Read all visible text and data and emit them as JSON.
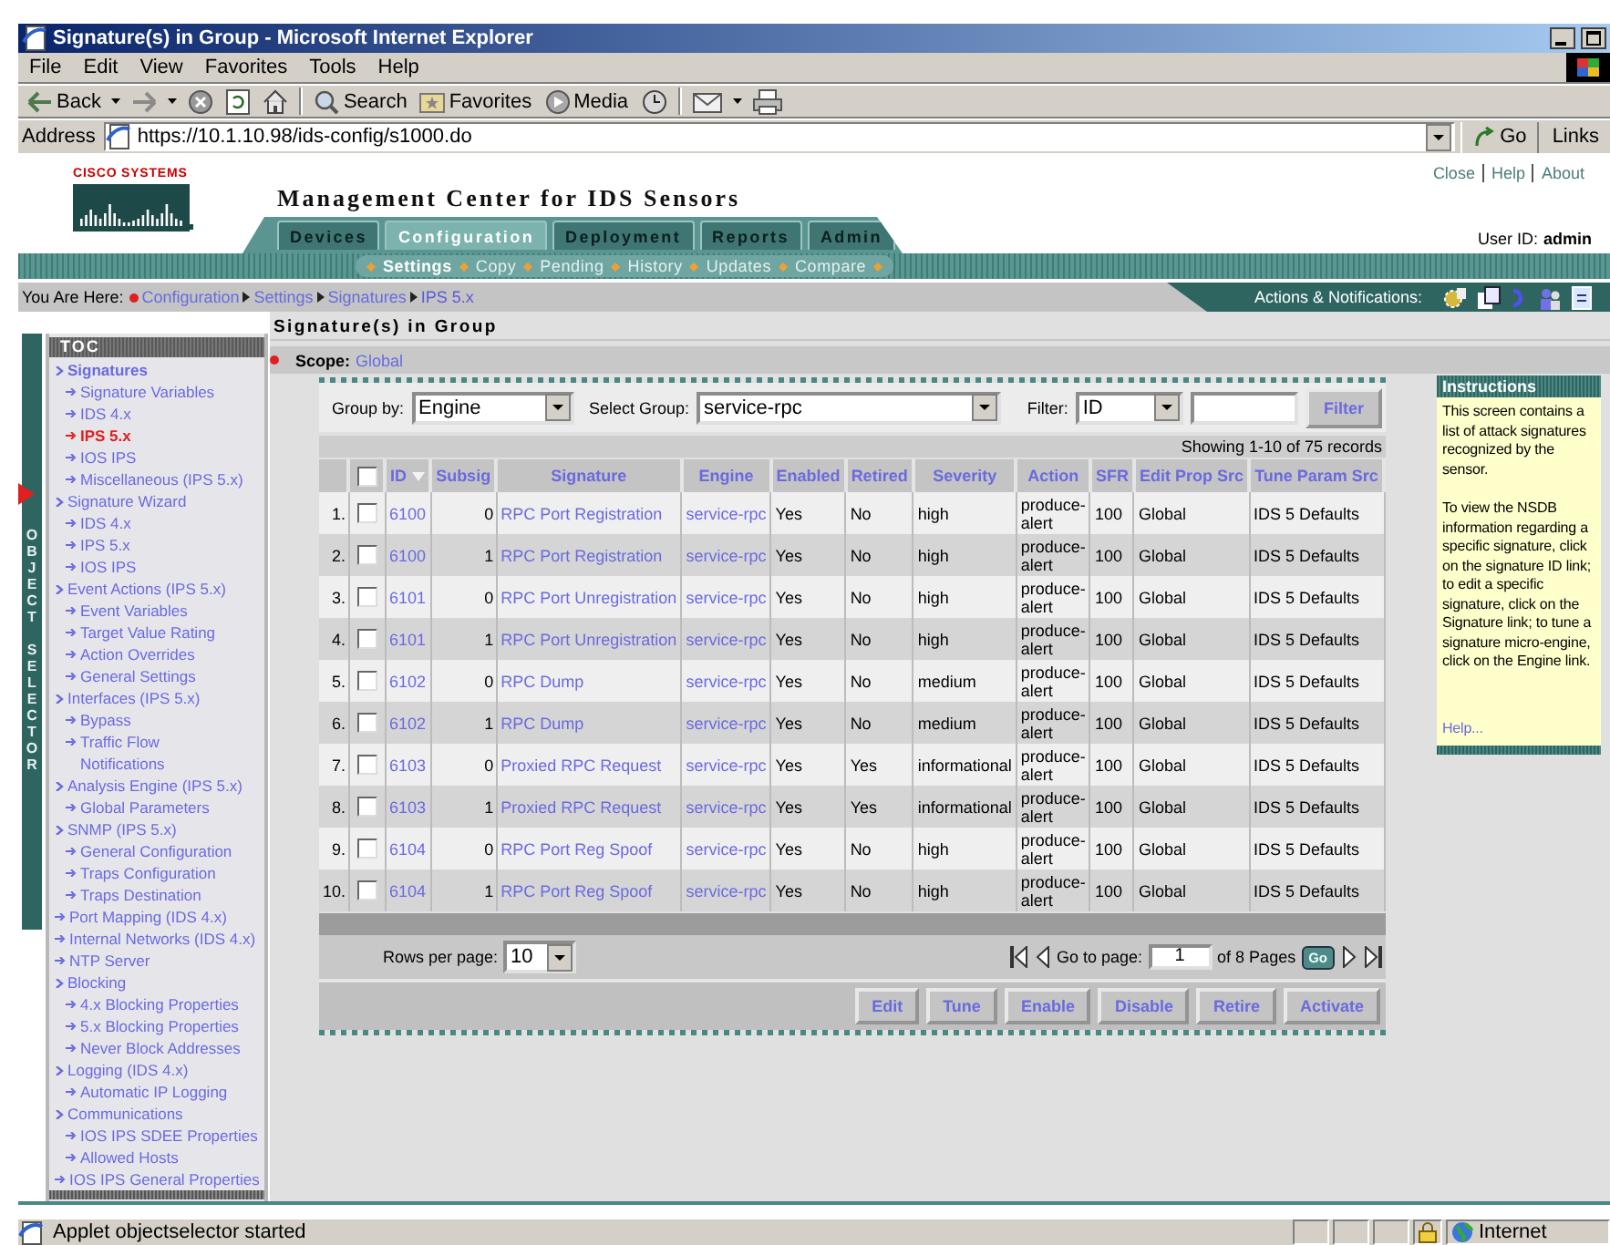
{
  "window": {
    "title": "Signature(s) in Group - Microsoft Internet Explorer"
  },
  "menu": [
    "File",
    "Edit",
    "View",
    "Favorites",
    "Tools",
    "Help"
  ],
  "toolbar": [
    {
      "kind": "back",
      "label": "Back"
    },
    {
      "kind": "forward"
    },
    {
      "kind": "stop"
    },
    {
      "kind": "refresh"
    },
    {
      "kind": "home"
    },
    {
      "kind": "search",
      "label": "Search"
    },
    {
      "kind": "favorites",
      "label": "Favorites"
    },
    {
      "kind": "media",
      "label": "Media"
    },
    {
      "kind": "history"
    },
    {
      "kind": "mail"
    },
    {
      "kind": "print"
    }
  ],
  "address": {
    "label": "Address",
    "url": "https://10.1.10.98/ids-config/s1000.do",
    "go": "Go",
    "links": "Links"
  },
  "header": {
    "logo": "CISCO SYSTEMS",
    "title": "Management Center for IDS Sensors",
    "links": [
      "Close",
      "Help",
      "About"
    ],
    "user_label": "User ID:",
    "user": "admin"
  },
  "tabs": [
    {
      "label": "Devices",
      "selected": false
    },
    {
      "label": "Configuration",
      "selected": true
    },
    {
      "label": "Deployment",
      "selected": false
    },
    {
      "label": "Reports",
      "selected": false
    },
    {
      "label": "Admin",
      "selected": false
    }
  ],
  "subnav": [
    {
      "label": "Settings",
      "selected": true
    },
    {
      "label": "Copy",
      "selected": false
    },
    {
      "label": "Pending",
      "selected": false
    },
    {
      "label": "History",
      "selected": false
    },
    {
      "label": "Updates",
      "selected": false
    },
    {
      "label": "Compare",
      "selected": false
    }
  ],
  "breadcrumb": {
    "label": "You Are Here:",
    "items": [
      "Configuration",
      "Settings",
      "Signatures",
      "IPS 5.x"
    ]
  },
  "actions_label": "Actions & Notifications:",
  "object_selector": [
    "OBJECT",
    "SELECTOR"
  ],
  "toc": {
    "title": "TOC",
    "items": [
      {
        "label": "Signatures",
        "selected": false,
        "children": [
          {
            "label": "Signature Variables",
            "selected": false
          },
          {
            "label": "IDS 4.x",
            "selected": false
          },
          {
            "label": "IPS 5.x",
            "selected": true
          },
          {
            "label": "IOS IPS",
            "selected": false
          },
          {
            "label": "Miscellaneous (IPS 5.x)",
            "selected": false
          }
        ]
      },
      {
        "label": "Signature Wizard",
        "selected": false,
        "children": [
          {
            "label": "IDS 4.x",
            "selected": false
          },
          {
            "label": "IPS 5.x",
            "selected": false
          },
          {
            "label": "IOS IPS",
            "selected": false
          }
        ]
      },
      {
        "label": "Event Actions (IPS 5.x)",
        "selected": false,
        "children": [
          {
            "label": "Event Variables",
            "selected": false
          },
          {
            "label": "Target Value Rating",
            "selected": false
          },
          {
            "label": "Action Overrides",
            "selected": false
          },
          {
            "label": "General Settings",
            "selected": false
          }
        ]
      },
      {
        "label": "Interfaces (IPS 5.x)",
        "selected": false,
        "children": [
          {
            "label": "Bypass",
            "selected": false
          },
          {
            "label": "Traffic Flow\nNotifications",
            "selected": false
          }
        ]
      },
      {
        "label": "Analysis Engine (IPS 5.x)",
        "selected": false,
        "children": [
          {
            "label": "Global Parameters",
            "selected": false
          }
        ]
      },
      {
        "label": "SNMP (IPS 5.x)",
        "selected": false,
        "children": [
          {
            "label": "General Configuration",
            "selected": false
          },
          {
            "label": "Traps Configuration",
            "selected": false
          },
          {
            "label": "Traps Destination",
            "selected": false
          }
        ]
      },
      {
        "label": "Port Mapping (IDS 4.x)",
        "selected": false
      },
      {
        "label": "Internal Networks (IDS 4.x)",
        "selected": false
      },
      {
        "label": "NTP Server",
        "selected": false
      },
      {
        "label": "Blocking",
        "selected": false,
        "children": [
          {
            "label": "4.x Blocking Properties",
            "selected": false
          },
          {
            "label": "5.x Blocking Properties",
            "selected": false
          },
          {
            "label": "Never Block Addresses",
            "selected": false
          }
        ]
      },
      {
        "label": "Logging (IDS 4.x)",
        "selected": false,
        "children": [
          {
            "label": "Automatic IP Logging",
            "selected": false
          }
        ]
      },
      {
        "label": "Communications",
        "selected": false,
        "children": [
          {
            "label": "IOS IPS SDEE Properties",
            "selected": false
          },
          {
            "label": "Allowed Hosts",
            "selected": false
          }
        ]
      },
      {
        "label": "IOS IPS General Properties",
        "selected": false
      }
    ]
  },
  "page_title": "Signature(s) in Group",
  "scope": {
    "label": "Scope:",
    "value": "Global"
  },
  "filters": {
    "group_by_label": "Group by:",
    "group_by": "Engine",
    "group_label": "Select Group:",
    "group": "service-rpc",
    "filter_label": "Filter:",
    "filter_field": "ID",
    "filter_button": "Filter"
  },
  "records": "Showing 1-10 of 75 records",
  "table": {
    "header_checked": false,
    "columns": [
      {
        "label": "ID",
        "kind": "link",
        "sorted": true
      },
      {
        "label": "Subsig",
        "kind": "number",
        "sorted": false
      },
      {
        "label": "Signature",
        "kind": "link",
        "sorted": false
      },
      {
        "label": "Engine",
        "kind": "link",
        "sorted": false
      },
      {
        "label": "Enabled",
        "kind": "text",
        "sorted": false
      },
      {
        "label": "Retired",
        "kind": "text",
        "sorted": false
      },
      {
        "label": "Severity",
        "kind": "text",
        "sorted": false
      },
      {
        "label": "Action",
        "kind": "wrap",
        "sorted": false
      },
      {
        "label": "SFR",
        "kind": "text",
        "sorted": false
      },
      {
        "label": "Edit Prop Src",
        "kind": "text",
        "sorted": false
      },
      {
        "label": "Tune Param Src",
        "kind": "text",
        "sorted": false
      }
    ],
    "rows": [
      {
        "num": "1.",
        "checked": false,
        "cells": [
          "6100",
          "0",
          "RPC Port Registration",
          "service-rpc",
          "Yes",
          "No",
          "high",
          "produce-alert",
          "100",
          "Global",
          "IDS 5 Defaults"
        ]
      },
      {
        "num": "2.",
        "checked": false,
        "cells": [
          "6100",
          "1",
          "RPC Port Registration",
          "service-rpc",
          "Yes",
          "No",
          "high",
          "produce-alert",
          "100",
          "Global",
          "IDS 5 Defaults"
        ]
      },
      {
        "num": "3.",
        "checked": false,
        "cells": [
          "6101",
          "0",
          "RPC Port Unregistration",
          "service-rpc",
          "Yes",
          "No",
          "high",
          "produce-alert",
          "100",
          "Global",
          "IDS 5 Defaults"
        ]
      },
      {
        "num": "4.",
        "checked": false,
        "cells": [
          "6101",
          "1",
          "RPC Port Unregistration",
          "service-rpc",
          "Yes",
          "No",
          "high",
          "produce-alert",
          "100",
          "Global",
          "IDS 5 Defaults"
        ]
      },
      {
        "num": "5.",
        "checked": false,
        "cells": [
          "6102",
          "0",
          "RPC Dump",
          "service-rpc",
          "Yes",
          "No",
          "medium",
          "produce-alert",
          "100",
          "Global",
          "IDS 5 Defaults"
        ]
      },
      {
        "num": "6.",
        "checked": false,
        "cells": [
          "6102",
          "1",
          "RPC Dump",
          "service-rpc",
          "Yes",
          "No",
          "medium",
          "produce-alert",
          "100",
          "Global",
          "IDS 5 Defaults"
        ]
      },
      {
        "num": "7.",
        "checked": false,
        "cells": [
          "6103",
          "0",
          "Proxied RPC Request",
          "service-rpc",
          "Yes",
          "Yes",
          "informational",
          "produce-alert",
          "100",
          "Global",
          "IDS 5 Defaults"
        ]
      },
      {
        "num": "8.",
        "checked": false,
        "cells": [
          "6103",
          "1",
          "Proxied RPC Request",
          "service-rpc",
          "Yes",
          "Yes",
          "informational",
          "produce-alert",
          "100",
          "Global",
          "IDS 5 Defaults"
        ]
      },
      {
        "num": "9.",
        "checked": false,
        "cells": [
          "6104",
          "0",
          "RPC Port Reg Spoof",
          "service-rpc",
          "Yes",
          "No",
          "high",
          "produce-alert",
          "100",
          "Global",
          "IDS 5 Defaults"
        ]
      },
      {
        "num": "10.",
        "checked": false,
        "cells": [
          "6104",
          "1",
          "RPC Port Reg Spoof",
          "service-rpc",
          "Yes",
          "No",
          "high",
          "produce-alert",
          "100",
          "Global",
          "IDS 5 Defaults"
        ]
      }
    ]
  },
  "pagination": {
    "rows_label": "Rows per page:",
    "rows": "10",
    "goto_label": "Go to page:",
    "page": "1",
    "pages": "of 8 Pages",
    "go": "Go"
  },
  "buttons": [
    "Edit",
    "Tune",
    "Enable",
    "Disable",
    "Retire",
    "Activate"
  ],
  "instructions": {
    "title": "Instructions",
    "paragraphs": [
      "This screen contains a list of attack signatures recognized by the sensor.",
      "To view the NSDB information regarding a specific signature, click on the signature ID link; to edit a specific signature, click on the Signature link; to tune a signature micro-engine, click on the Engine link."
    ],
    "help": "Help..."
  },
  "status": {
    "text": "Applet objectselector started",
    "zone": "Internet"
  }
}
